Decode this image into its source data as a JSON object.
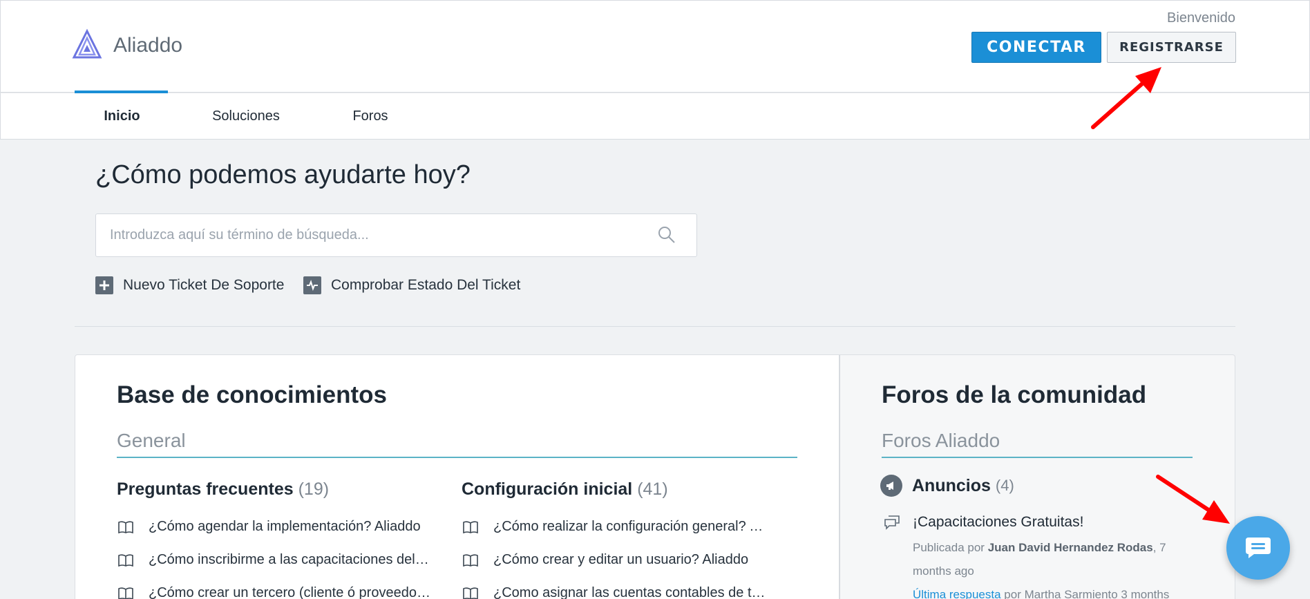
{
  "header": {
    "brand": "Aliaddo",
    "welcome": "Bienvenido",
    "connect_label": "CONECTAR",
    "register_label": "REGISTRARSE",
    "accent_color": "#1b8fd6"
  },
  "nav": {
    "tabs": [
      {
        "label": "Inicio",
        "active": true
      },
      {
        "label": "Soluciones",
        "active": false
      },
      {
        "label": "Foros",
        "active": false
      }
    ]
  },
  "search": {
    "title": "¿Cómo podemos ayudarte hoy?",
    "placeholder": "Introduzca aquí su término de búsqueda...",
    "icon": "search-icon"
  },
  "quick_links": [
    {
      "label": "Nuevo Ticket De Soporte",
      "icon": "plus-icon"
    },
    {
      "label": "Comprobar Estado Del Ticket",
      "icon": "activity-icon"
    }
  ],
  "knowledge_base": {
    "title": "Base de conocimientos",
    "section": "General",
    "categories": [
      {
        "title": "Preguntas frecuentes",
        "count": "(19)",
        "articles": [
          "¿Cómo agendar la implementación? Aliaddo",
          "¿Cómo inscribirme a las capacitaciones del s…",
          "¿Cómo crear un tercero (cliente ó proveedor…"
        ]
      },
      {
        "title": "Configuración inicial",
        "count": "(41)",
        "articles": [
          "¿Cómo realizar la configuración general? Ali…",
          "¿Cómo crear y editar un usuario? Aliaddo",
          "¿Como asignar las cuentas contables de tes…"
        ]
      }
    ]
  },
  "forums": {
    "title": "Foros de la comunidad",
    "section": "Foros Aliaddo",
    "category": {
      "label": "Anuncios",
      "count": "(4)",
      "icon": "megaphone-icon"
    },
    "topic": {
      "title": "¡Capacitaciones Gratuitas!",
      "posted_by_prefix": "Publicada por",
      "author": "Juan David Hernandez Rodas",
      "posted_ago": ", 7 months ago",
      "last_reply_label": "Última respuesta",
      "last_reply_suffix": "por Martha Sarmiento 3 months"
    }
  },
  "chat": {
    "icon": "chat-icon"
  },
  "annotation_color": "#ff0000"
}
